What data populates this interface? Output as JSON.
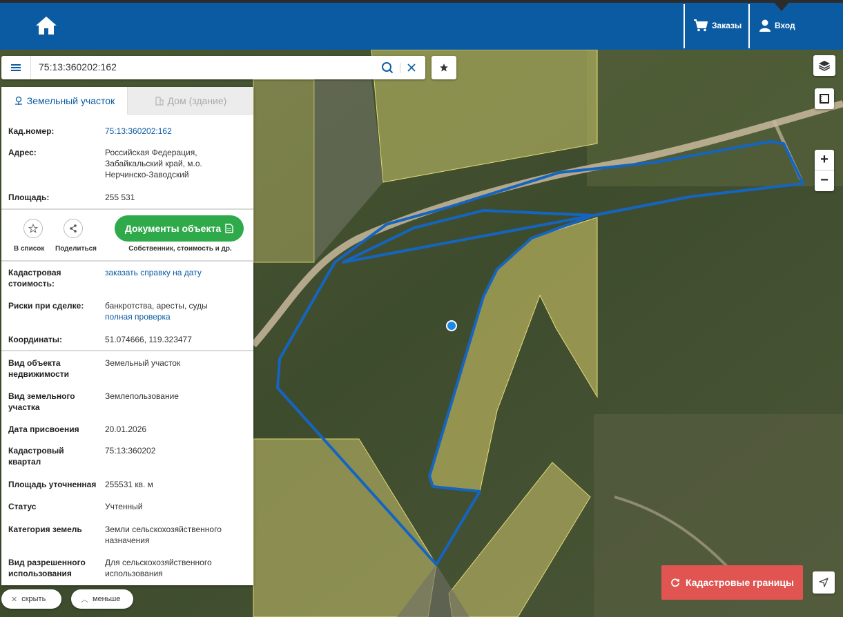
{
  "header": {
    "orders_label": "Заказы",
    "login_label": "Вход"
  },
  "search": {
    "query": "75:13:360202:162"
  },
  "tabs": [
    {
      "label": "Земельный участок",
      "active": true
    },
    {
      "label": "Дом (здание)",
      "active": false
    }
  ],
  "parcel": {
    "cad_number": {
      "label": "Кад.номер:",
      "value": "75:13:360202:162"
    },
    "address": {
      "label": "Адрес:",
      "value": "Российская Федерация, Забайкальский край, м.о. Нерчинско-Заводский"
    },
    "area": {
      "label": "Площадь:",
      "value": "255 531"
    },
    "actions": {
      "add_to_list": "В список",
      "share": "Поделиться",
      "documents": "Документы объекта",
      "documents_sub": "Собственник, стоимость и др."
    },
    "cad_value": {
      "label": "Кадастровая стоимость:",
      "value": "заказать справку на дату"
    },
    "risks": {
      "label": "Риски при сделке:",
      "value": "банкротства, аресты, суды",
      "link": "полная проверка"
    },
    "coords": {
      "label": "Координаты:",
      "value": "51.074666, 119.323477"
    },
    "object_type": {
      "label": "Вид объекта недвижимости",
      "value": "Земельный участок"
    },
    "land_type": {
      "label": "Вид земельного участка",
      "value": "Землепользование"
    },
    "assign_date": {
      "label": "Дата присвоения",
      "value": "20.01.2026"
    },
    "cad_quarter": {
      "label": "Кадастровый квартал",
      "value": "75:13:360202"
    },
    "area_precise": {
      "label": "Площадь уточненная",
      "value": "255531 кв. м"
    },
    "status": {
      "label": "Статус",
      "value": "Учтенный"
    },
    "land_category": {
      "label": "Категория земель",
      "value": "Земли сельскохозяйственного назначения"
    },
    "permitted_use": {
      "label": "Вид разрешенного использования",
      "value": "Для сельскохозяйственного использования"
    }
  },
  "map": {
    "kadastr_button": "Кадастровые границы",
    "hide_button": "скрыть",
    "less_button": "меньше",
    "zoom_in": "+",
    "zoom_out": "−"
  },
  "colors": {
    "header": "#0b5ba3",
    "docs_button": "#2eaa4a",
    "kadastr_button": "#e05552",
    "parcel_outline": "#1565c0",
    "parcel_fill": "#d9cf6a"
  }
}
